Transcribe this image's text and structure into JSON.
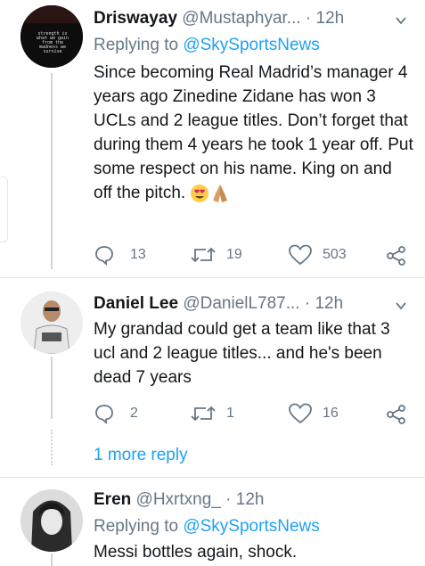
{
  "tweets": [
    {
      "name": "Driswayay",
      "handle": "@Mustaphyar...",
      "time": "· 12h",
      "replying_label": "Replying to",
      "replying_to": "@SkySportsNews",
      "text": "Since becoming Real Madrid’s manager 4 years ago Zinedine Zidane has won 3 UCLs and 2 league titles. Don’t forget that during them 4 years he took 1 year off. Put some respect on his name. King on and off the pitch.",
      "emoji": [
        "heart-eyes",
        "folded-hands"
      ],
      "replies": "13",
      "retweets": "19",
      "likes": "503",
      "avatar_text": "strength is what we gain from the madness we survive"
    },
    {
      "name": "Daniel Lee",
      "handle": "@DanielL787...",
      "time": "· 12h",
      "text": "My grandad could get a team like that 3 ucl and 2 league titles... and he's been dead 7 years",
      "replies": "2",
      "retweets": "1",
      "likes": "16"
    },
    {
      "name": "Eren",
      "handle": "@Hxrtxng_",
      "time": "· 12h",
      "replying_label": "Replying to",
      "replying_to": "@SkySportsNews",
      "text": "Messi bottles again, shock."
    }
  ],
  "more_replies": "1 more reply",
  "colors": {
    "accent": "#1da1f2",
    "muted": "#657786",
    "line": "#ccd6dd"
  }
}
